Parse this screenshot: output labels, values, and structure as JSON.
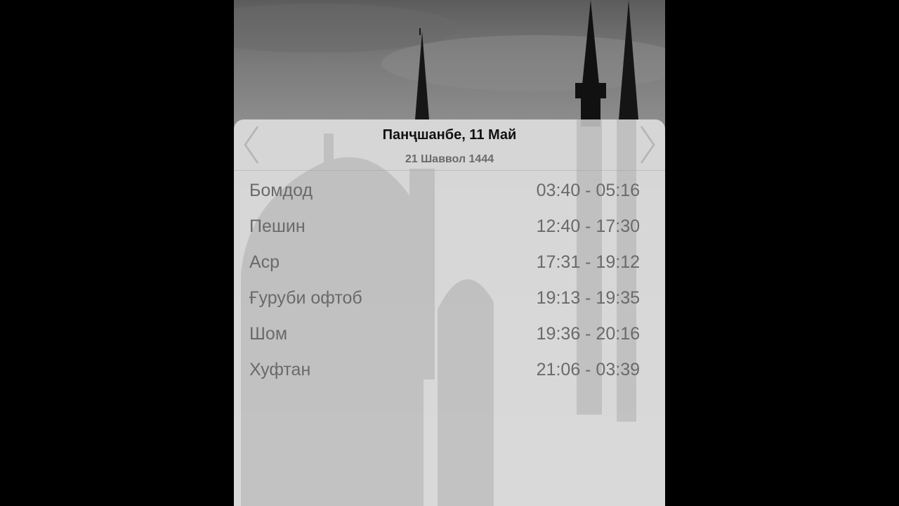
{
  "header": {
    "date": "Панҷшанбе, 11 Май",
    "hijri_date": "21 Шаввол 1444"
  },
  "nav": {
    "prev_icon": "chevron-left-icon",
    "next_icon": "chevron-right-icon"
  },
  "prayers": [
    {
      "name": "Бомдод",
      "time": "03:40 - 05:16"
    },
    {
      "name": "Пешин",
      "time": "12:40 - 17:30"
    },
    {
      "name": "Аср",
      "time": "17:31 - 19:12"
    },
    {
      "name": "Ғуруби офтоб",
      "time": "19:13 - 19:35"
    },
    {
      "name": "Шом",
      "time": "19:36 - 20:16"
    },
    {
      "name": "Хуфтан",
      "time": "21:06 - 03:39"
    }
  ],
  "colors": {
    "background": "#000000",
    "card": "#e2e2e2",
    "title_text": "#111111",
    "secondary_text": "#6a6a6a"
  }
}
